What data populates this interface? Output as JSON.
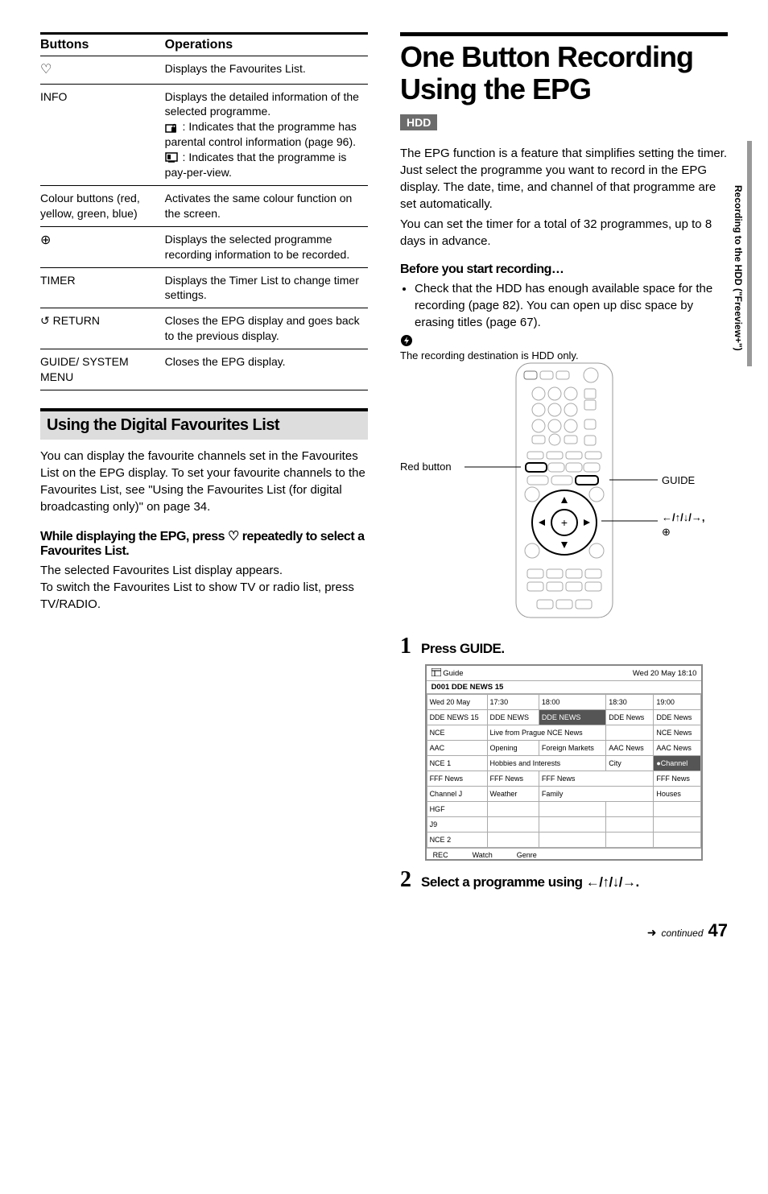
{
  "sidebar_text": "Recording to the HDD (\"Freeview+\")",
  "table": {
    "headers": [
      "Buttons",
      "Operations"
    ],
    "rows": [
      {
        "btn_icon": "♡",
        "btn_text": "",
        "op": "Displays the Favourites List."
      },
      {
        "btn_icon": "",
        "btn_text": "INFO",
        "op_pre": "Displays the detailed information of the selected programme.",
        "op_icon1_label": " : Indicates that the programme has parental control information (page 96).",
        "op_icon2_label": " : Indicates that the programme is pay-per-view."
      },
      {
        "btn_icon": "",
        "btn_text": "Colour buttons (red, yellow, green, blue)",
        "op": "Activates the same colour function on the screen."
      },
      {
        "btn_icon": "⊕",
        "btn_text": "",
        "op": "Displays the selected programme recording information to be recorded."
      },
      {
        "btn_icon": "",
        "btn_text": "TIMER",
        "op": "Displays the Timer List to change timer settings."
      },
      {
        "btn_icon": "↺",
        "btn_text": " RETURN",
        "op": "Closes the EPG display and goes back to the previous display."
      },
      {
        "btn_icon": "",
        "btn_text": "GUIDE/ SYSTEM MENU",
        "op": "Closes the EPG display."
      }
    ]
  },
  "section_fav": {
    "title": "Using the Digital Favourites List",
    "p1": "You can display the favourite channels set in the Favourites List on the EPG display. To set your favourite channels to the Favourites List, see \"Using the Favourites List (for digital broadcasting only)\" on page 34.",
    "sub_prefix": "While displaying the EPG, press ",
    "sub_suffix": " repeatedly to select a Favourites List.",
    "p2a": "The selected Favourites List display appears.",
    "p2b": "To switch the Favourites List to show TV or radio list, press TV/RADIO."
  },
  "right": {
    "title": "One Button Recording Using the EPG",
    "badge": "HDD",
    "p1": "The EPG function is a feature that simplifies setting the timer. Just select the programme you want to record in the EPG display. The date, time, and channel of that programme are set automatically.",
    "p2": "You can set the timer for a total of 32 programmes, up to 8 days in advance.",
    "sub1": "Before you start recording…",
    "bullet1": "Check that the HDD has enough available space for the recording (page 82). You can open up disc space by erasing titles (page 67).",
    "note": "The recording destination is HDD only.",
    "label_red": "Red button",
    "label_guide": "GUIDE",
    "label_arrows": "←/↑/↓/→,",
    "label_plus": "⊕",
    "step1": "Press GUIDE.",
    "step2_prefix": "Select a programme using ",
    "step2_arrows": "←/↑/↓/→",
    "step2_suffix": "."
  },
  "epg": {
    "guide_label": "Guide",
    "clock": "Wed 20 May 18:10",
    "channel_title": "D001 DDE NEWS 15",
    "time_cols": [
      "17:30",
      "18:00",
      "18:30",
      "19:00"
    ],
    "rows": [
      {
        "ch": "Wed 20 May",
        "cells": [
          "17:30",
          "18:00",
          "18:30",
          "19:00"
        ]
      },
      {
        "ch": "DDE NEWS 15",
        "cells": [
          "DDE NEWS",
          "DDE NEWS",
          "DDE News",
          "DDE News"
        ]
      },
      {
        "ch": "NCE",
        "cells": [
          "Live from Prague",
          "NCE News",
          "",
          "NCE News"
        ]
      },
      {
        "ch": "AAC",
        "cells": [
          "Opening",
          "Foreign Markets",
          "AAC News",
          "AAC News"
        ]
      },
      {
        "ch": "NCE 1",
        "cells": [
          "Hobbies and Interests",
          "",
          "City",
          "●Channel"
        ]
      },
      {
        "ch": "FFF News",
        "cells": [
          "FFF News",
          "FFF News",
          "",
          "FFF News"
        ]
      },
      {
        "ch": "Channel J",
        "cells": [
          "Weather",
          "Family",
          "",
          "Houses"
        ]
      },
      {
        "ch": "HGF",
        "cells": [
          "",
          "",
          "",
          ""
        ]
      },
      {
        "ch": "J9",
        "cells": [
          "",
          "",
          "",
          ""
        ]
      },
      {
        "ch": "NCE 2",
        "cells": [
          "",
          "",
          "",
          ""
        ]
      }
    ],
    "footer": [
      "REC",
      "Watch",
      "Genre"
    ]
  },
  "footer": {
    "continued": "continued",
    "page": "47"
  }
}
